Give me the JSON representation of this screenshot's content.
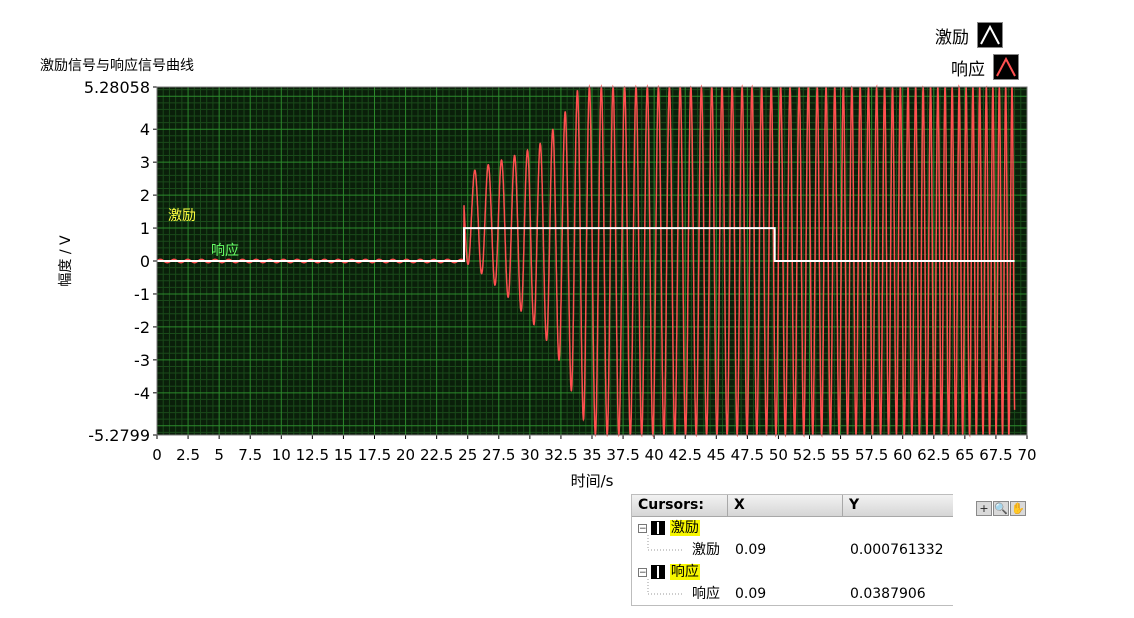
{
  "chart_title": "激励信号与响应信号曲线",
  "legend": [
    {
      "label": "激励",
      "color": "#ffffff"
    },
    {
      "label": "响应",
      "color": "#ff5050"
    }
  ],
  "plot_labels": {
    "excitation": "激励",
    "response": "响应"
  },
  "chart_data": {
    "type": "line",
    "title": "激励信号与响应信号曲线",
    "xlabel": "时间/s",
    "ylabel": "幅度 / V",
    "xlim": [
      0,
      70
    ],
    "ylim": [
      -5.2799,
      5.28058
    ],
    "x_ticks": [
      "0",
      "2.5",
      "5",
      "7.5",
      "10",
      "12.5",
      "15",
      "17.5",
      "20",
      "22.5",
      "25",
      "27.5",
      "30",
      "32.5",
      "35",
      "37.5",
      "40",
      "42.5",
      "45",
      "47.5",
      "50",
      "52.5",
      "55",
      "57.5",
      "60",
      "62.5",
      "65",
      "67.5",
      "70"
    ],
    "y_ticks": [
      "5.28058",
      "4",
      "3",
      "2",
      "1",
      "0",
      "-1",
      "-2",
      "-3",
      "-4",
      "-5.2799"
    ],
    "grid": true,
    "background": "#0a1f0a",
    "series": [
      {
        "name": "激励",
        "color": "#ffffff",
        "x": [
          0,
          24.7,
          24.7,
          49.7,
          49.7,
          69
        ],
        "y": [
          0,
          0,
          1,
          1,
          0,
          0
        ]
      },
      {
        "name": "响应",
        "color": "#ff5050",
        "description_points": {
          "pre_step_x": [
            0,
            24.7
          ],
          "pre_step_amplitude": 0.05,
          "peak_x": [
            25.2,
            26.5,
            28.0,
            29.5,
            31.0,
            32.5,
            34.0,
            35.0,
            69.0
          ],
          "peak_y_max": [
            2.7,
            2.9,
            3.1,
            3.3,
            3.6,
            4.3,
            5.28058,
            5.28058,
            5.28058
          ],
          "peak_y_min": [
            -0.1,
            -0.5,
            -1.0,
            -1.6,
            -2.2,
            -3.1,
            -4.6,
            -5.2799,
            -5.2799
          ],
          "period_start": 1.1,
          "period_end": 0.5
        }
      }
    ]
  },
  "cursors": {
    "headers": [
      "Cursors:",
      "X",
      "Y"
    ],
    "groups": [
      {
        "name": "激励",
        "item": "激励",
        "x": "0.09",
        "y": "0.000761332"
      },
      {
        "name": "响应",
        "item": "响应",
        "x": "0.09",
        "y": "0.0387906"
      }
    ]
  },
  "tools": [
    "+",
    "🔍",
    "✋"
  ]
}
